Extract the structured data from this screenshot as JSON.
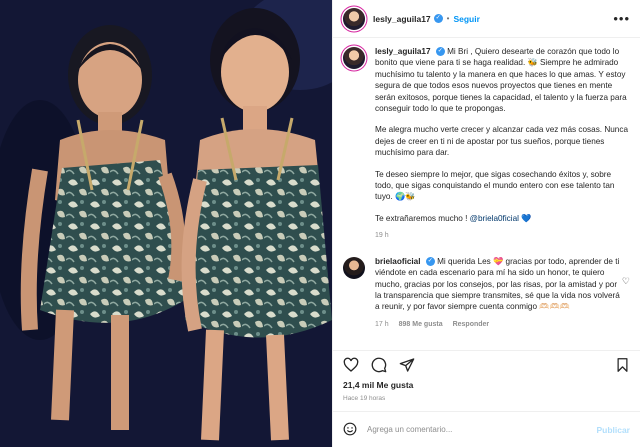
{
  "post": {
    "username": "lesly_aguila17",
    "verified_mark": "✓",
    "separator": "•",
    "follow_label": "Seguir",
    "more_label": "•••"
  },
  "caption": {
    "username": "lesly_aguila17",
    "verified_mark": "✓",
    "para1": "Mi Bri , Quiero desearte de corazón que todo lo bonito que viene para ti se haga realidad. 🐝 Siempre he admirado muchísimo tu talento y la manera en que haces lo que amas. Y estoy segura de que todos esos nuevos proyectos que tienes en mente serán exitosos, porque tienes la capacidad, el talento y la fuerza para conseguir todo lo que te propongas.",
    "para2": "Me alegra mucho verte crecer y alcanzar cada vez más cosas. Nunca dejes de creer en ti ni de apostar por tus sueños, porque tienes muchísimo para dar.",
    "para3": "Te deseo siempre lo mejor, que sigas cosechando éxitos y, sobre todo, que sigas conquistando el mundo entero con ese talento tan tuyo. 🌍🐝",
    "para4_text": "Te extrañaremos mucho !",
    "para4_mention": "@briela0ficial",
    "para4_heart": "💙",
    "time": "19 h"
  },
  "reply": {
    "username": "brielaoficial",
    "verified_mark": "✓",
    "text": "Mi querida Les 💝 gracias por todo, aprender de ti viéndote en cada escenario para mí ha sido un honor, te quiero mucho, gracias por los consejos, por las risas, por la amistad y por la transparencia que siempre transmites, sé que la vida nos volverá a reunir, y por favor siempre cuenta conmigo 🫶🏻🫶🏻🫶🏻",
    "time": "17 h",
    "likes": "898 Me gusta",
    "reply_label": "Responder",
    "heart_icon": "♡"
  },
  "stats": {
    "likes": "21,4 mil Me gusta",
    "ago": "Hace 19 horas"
  },
  "composer": {
    "placeholder": "Agrega un comentario...",
    "post_label": "Publicar"
  },
  "icons": [
    "heart-icon",
    "comment-icon",
    "share-icon",
    "bookmark-icon",
    "emoji-icon",
    "verified-icon",
    "more-icon"
  ],
  "colors": {
    "link": "#0095f6",
    "verified": "#3797f0",
    "mention": "#00376b",
    "muted": "#8e8e8e"
  }
}
